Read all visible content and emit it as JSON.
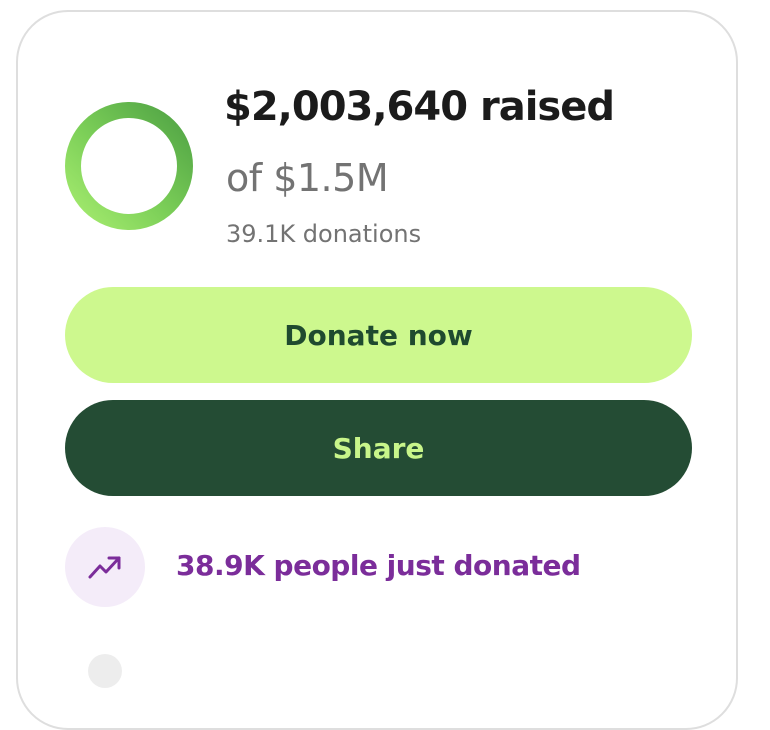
{
  "fundraiser": {
    "amount_raised": "$2,003,640 raised",
    "goal": "of $1.5M",
    "donation_count": "39.1K donations",
    "progress_fraction": 1.0
  },
  "actions": {
    "donate_label": "Donate now",
    "share_label": "Share"
  },
  "activity": {
    "icon": "trending-up-icon",
    "text": "38.9K people just donated"
  },
  "colors": {
    "ring_dark": "#4fa244",
    "ring_light": "#a6ec6f",
    "donate_bg": "#cdf88e",
    "share_bg": "#244c34",
    "activity_text": "#7b2d9a"
  }
}
